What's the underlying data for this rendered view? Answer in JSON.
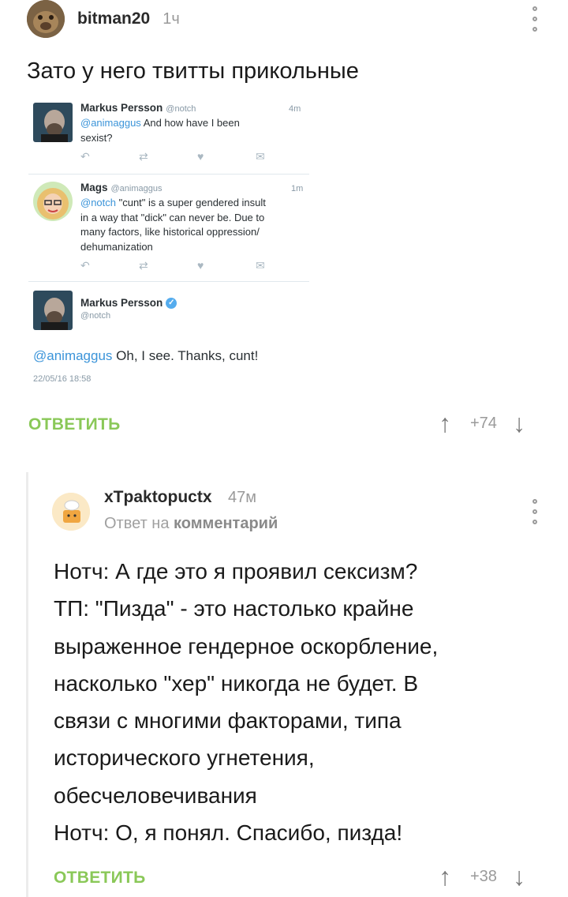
{
  "comment1": {
    "username": "bitman20",
    "time": "1ч",
    "text": "Зато у него твитты прикольные",
    "reply_label": "ОТВЕТИТЬ",
    "score": "+74",
    "tweets": [
      {
        "name": "Markus Persson",
        "handle": "@notch",
        "time": "4m",
        "mention": "@animaggus",
        "lines": [
          " And how have I been",
          "sexist?"
        ]
      },
      {
        "name": "Mags",
        "handle": "@animaggus",
        "time": "1m",
        "mention": "@notch",
        "lines": [
          " \"cunt\" is a super gendered insult",
          "in a way that \"dick\" can never be. Due to",
          "many factors, like historical oppression/",
          "dehumanization"
        ]
      }
    ],
    "expanded_tweet": {
      "name": "Markus Persson",
      "handle": "@notch",
      "mention": "@animaggus",
      "text": " Oh, I see. Thanks, cunt!",
      "date": "22/05/16 18:58"
    }
  },
  "comment2": {
    "username": "xTpaktopuctx",
    "time": "47м",
    "reply_to_prefix": "Ответ на",
    "reply_to_link": "комментарий",
    "lines": [
      "Нотч: А где это я проявил сексизм?",
      "ТП: \"Пизда\" - это настолько крайне",
      "выраженное гендерное оскорбление,",
      "насколько \"хер\" никогда не будет. В",
      "связи с многими факторами, типа",
      "исторического угнетения,",
      "обесчеловечивания",
      "Нотч: О, я понял. Спасибо, пизда!"
    ],
    "reply_label": "ОТВЕТИТЬ",
    "score": "+38"
  },
  "icons": {
    "reply": "↶",
    "retweet": "⇄",
    "like": "♥",
    "dm": "✉",
    "upvote": "↑",
    "downvote": "↓"
  },
  "colors": {
    "reply_green": "#8ac858",
    "twitter_blue": "#3b94d9",
    "verified_blue": "#55acee"
  }
}
